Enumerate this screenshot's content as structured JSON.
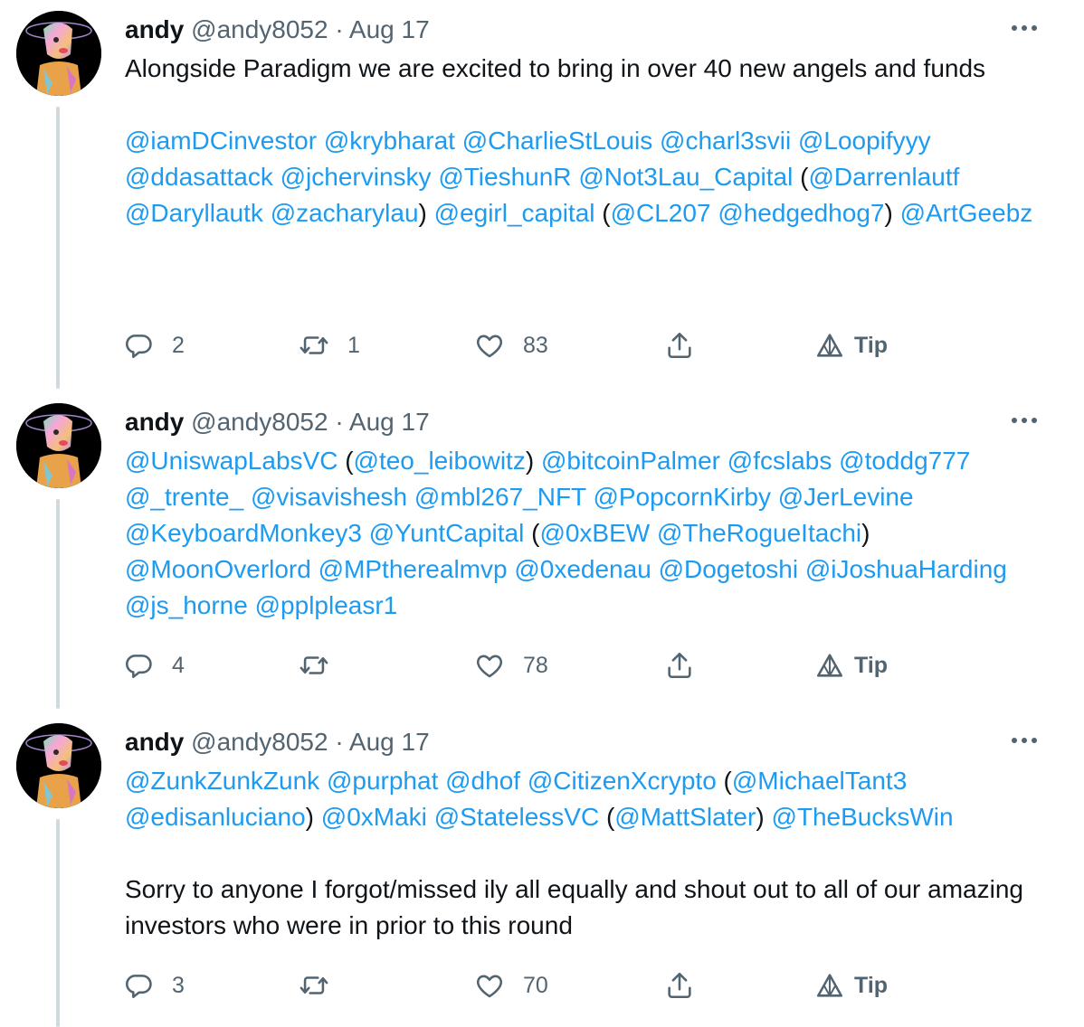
{
  "colors": {
    "link": "#1d9bf0",
    "muted": "#536471",
    "text": "#0f1419",
    "thread": "#cfd9de"
  },
  "icons": {
    "reply": "reply-icon",
    "retweet": "retweet-icon",
    "like": "heart-icon",
    "share": "share-icon",
    "tip": "tip-icon",
    "more": "more-dots-icon"
  },
  "tweets": [
    {
      "author": {
        "name": "andy",
        "handle": "@andy8052",
        "dot": "·",
        "date": "Aug 17"
      },
      "body": [
        {
          "type": "text",
          "value": "Alongside Paradigm we are excited to bring in over 40 new angels and funds\n\n"
        },
        {
          "type": "mention",
          "value": "@iamDCinvestor"
        },
        {
          "type": "text",
          "value": " "
        },
        {
          "type": "mention",
          "value": "@krybharat"
        },
        {
          "type": "text",
          "value": " "
        },
        {
          "type": "mention",
          "value": "@CharlieStLouis"
        },
        {
          "type": "text",
          "value": " "
        },
        {
          "type": "mention",
          "value": "@charl3svii"
        },
        {
          "type": "text",
          "value": " "
        },
        {
          "type": "mention",
          "value": "@Loopifyyy"
        },
        {
          "type": "text",
          "value": " "
        },
        {
          "type": "mention",
          "value": "@ddasattack"
        },
        {
          "type": "text",
          "value": " "
        },
        {
          "type": "mention",
          "value": "@jchervinsky"
        },
        {
          "type": "text",
          "value": " "
        },
        {
          "type": "mention",
          "value": "@TieshunR"
        },
        {
          "type": "text",
          "value": " "
        },
        {
          "type": "mention",
          "value": "@Not3Lau_Capital"
        },
        {
          "type": "text",
          "value": " ("
        },
        {
          "type": "mention",
          "value": "@Darrenlautf"
        },
        {
          "type": "text",
          "value": " "
        },
        {
          "type": "mention",
          "value": "@Daryllautk"
        },
        {
          "type": "text",
          "value": " "
        },
        {
          "type": "mention",
          "value": "@zacharylau"
        },
        {
          "type": "text",
          "value": ") "
        },
        {
          "type": "mention",
          "value": "@egirl_capital"
        },
        {
          "type": "text",
          "value": " ("
        },
        {
          "type": "mention",
          "value": "@CL207"
        },
        {
          "type": "text",
          "value": " "
        },
        {
          "type": "mention",
          "value": "@hedgedhog7"
        },
        {
          "type": "text",
          "value": ") "
        },
        {
          "type": "mention",
          "value": "@ArtGeebz"
        }
      ],
      "stats": {
        "replies": "2",
        "retweets": "1",
        "likes": "83",
        "tip": "Tip"
      }
    },
    {
      "author": {
        "name": "andy",
        "handle": "@andy8052",
        "dot": "·",
        "date": "Aug 17"
      },
      "body": [
        {
          "type": "mention",
          "value": "@UniswapLabsVC"
        },
        {
          "type": "text",
          "value": " ("
        },
        {
          "type": "mention",
          "value": "@teo_leibowitz"
        },
        {
          "type": "text",
          "value": ") "
        },
        {
          "type": "mention",
          "value": "@bitcoinPalmer"
        },
        {
          "type": "text",
          "value": " "
        },
        {
          "type": "mention",
          "value": "@fcslabs"
        },
        {
          "type": "text",
          "value": " "
        },
        {
          "type": "mention",
          "value": "@toddg777"
        },
        {
          "type": "text",
          "value": " "
        },
        {
          "type": "mention",
          "value": "@_trente_"
        },
        {
          "type": "text",
          "value": " "
        },
        {
          "type": "mention",
          "value": "@visavishesh"
        },
        {
          "type": "text",
          "value": " "
        },
        {
          "type": "mention",
          "value": "@mbl267_NFT"
        },
        {
          "type": "text",
          "value": " "
        },
        {
          "type": "mention",
          "value": "@PopcornKirby"
        },
        {
          "type": "text",
          "value": " "
        },
        {
          "type": "mention",
          "value": "@JerLevine"
        },
        {
          "type": "text",
          "value": " "
        },
        {
          "type": "mention",
          "value": "@KeyboardMonkey3"
        },
        {
          "type": "text",
          "value": " "
        },
        {
          "type": "mention",
          "value": "@YuntCapital"
        },
        {
          "type": "text",
          "value": " ("
        },
        {
          "type": "mention",
          "value": "@0xBEW"
        },
        {
          "type": "text",
          "value": " "
        },
        {
          "type": "mention",
          "value": "@TheRogueItachi"
        },
        {
          "type": "text",
          "value": ") "
        },
        {
          "type": "mention",
          "value": "@MoonOverlord"
        },
        {
          "type": "text",
          "value": " "
        },
        {
          "type": "mention",
          "value": "@MPtherealmvp"
        },
        {
          "type": "text",
          "value": " "
        },
        {
          "type": "mention",
          "value": "@0xedenau"
        },
        {
          "type": "text",
          "value": " "
        },
        {
          "type": "mention",
          "value": "@Dogetoshi"
        },
        {
          "type": "text",
          "value": " "
        },
        {
          "type": "mention",
          "value": "@iJoshuaHarding"
        },
        {
          "type": "text",
          "value": " "
        },
        {
          "type": "mention",
          "value": "@js_horne"
        },
        {
          "type": "text",
          "value": " "
        },
        {
          "type": "mention",
          "value": "@pplpleasr1"
        }
      ],
      "stats": {
        "replies": "4",
        "retweets": "",
        "likes": "78",
        "tip": "Tip"
      }
    },
    {
      "author": {
        "name": "andy",
        "handle": "@andy8052",
        "dot": "·",
        "date": "Aug 17"
      },
      "body": [
        {
          "type": "mention",
          "value": "@ZunkZunkZunk"
        },
        {
          "type": "text",
          "value": " "
        },
        {
          "type": "mention",
          "value": "@purphat"
        },
        {
          "type": "text",
          "value": " "
        },
        {
          "type": "mention",
          "value": "@dhof"
        },
        {
          "type": "text",
          "value": " "
        },
        {
          "type": "mention",
          "value": "@CitizenXcrypto"
        },
        {
          "type": "text",
          "value": " ("
        },
        {
          "type": "mention",
          "value": "@MichaelTant3"
        },
        {
          "type": "text",
          "value": " "
        },
        {
          "type": "mention",
          "value": "@edisanluciano"
        },
        {
          "type": "text",
          "value": ") "
        },
        {
          "type": "mention",
          "value": "@0xMaki"
        },
        {
          "type": "text",
          "value": " "
        },
        {
          "type": "mention",
          "value": "@StatelessVC"
        },
        {
          "type": "text",
          "value": " ("
        },
        {
          "type": "mention",
          "value": "@MattSlater"
        },
        {
          "type": "text",
          "value": ") "
        },
        {
          "type": "mention",
          "value": "@TheBucksWin"
        },
        {
          "type": "text",
          "value": "\n\nSorry to anyone I forgot/missed ily all equally and shout out to all of our amazing investors who were in prior to this round"
        }
      ],
      "stats": {
        "replies": "3",
        "retweets": "",
        "likes": "70",
        "tip": "Tip"
      }
    }
  ]
}
